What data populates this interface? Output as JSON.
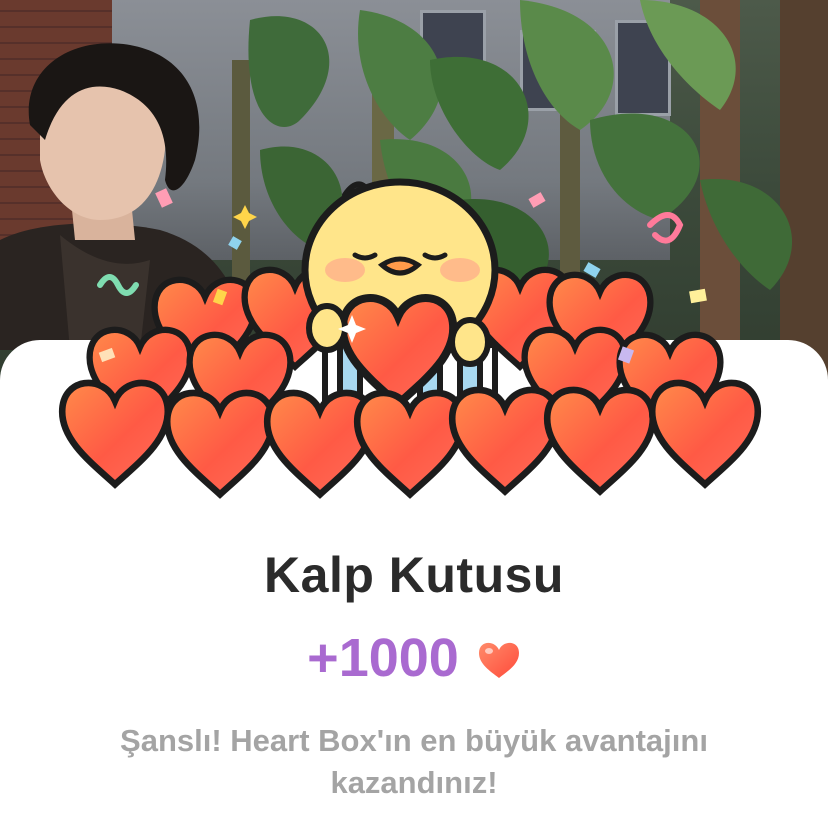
{
  "modal": {
    "title": "Kalp Kutusu",
    "reward_amount": "+1000",
    "reward_icon": "heart-icon",
    "message": "Şanslı! Heart Box'ın en büyük avantajını kazandınız!"
  },
  "colors": {
    "title": "#2b2b2b",
    "reward_amount": "#a96ad0",
    "message": "#a4a4a4",
    "heart": "#ff5a45",
    "card_background": "#ffffff"
  }
}
